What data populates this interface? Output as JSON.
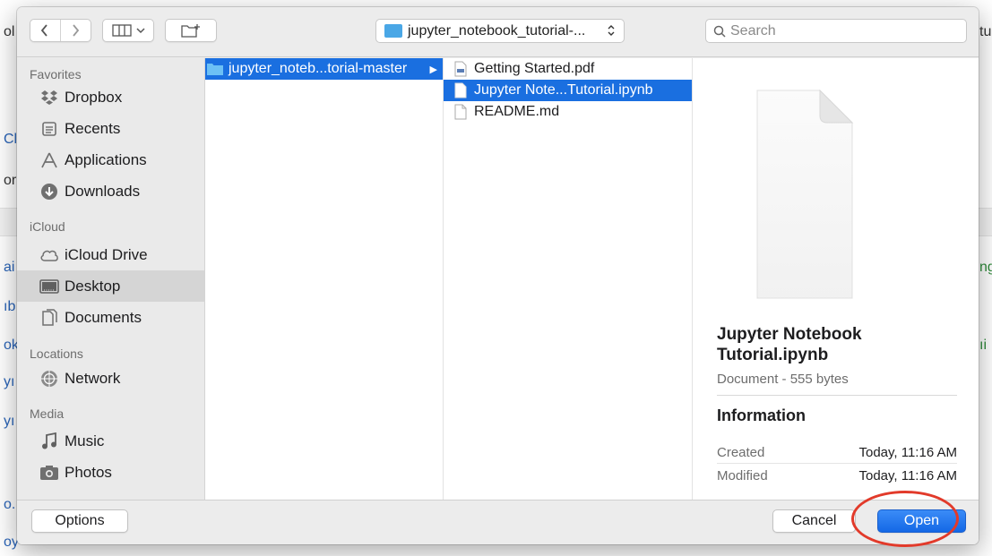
{
  "background": {
    "fragments": [
      "ol",
      "Cl",
      "or",
      "ai",
      "ıb",
      "ok",
      "yı",
      "yı",
      "o.",
      "oy",
      "tu",
      "ng",
      "ıi"
    ]
  },
  "toolbar": {
    "back_icon": "chevron-left-icon",
    "forward_icon": "chevron-right-icon",
    "view_icon": "column-view-icon",
    "new_folder_icon": "new-folder-icon",
    "path_label": "jupyter_notebook_tutorial-...",
    "search_placeholder": "Search"
  },
  "sidebar": {
    "sections": [
      {
        "header": "Favorites",
        "items": [
          {
            "label": "Dropbox",
            "icon": "dropbox-icon"
          },
          {
            "label": "Recents",
            "icon": "recents-icon"
          },
          {
            "label": "Applications",
            "icon": "applications-icon"
          },
          {
            "label": "Downloads",
            "icon": "downloads-icon"
          }
        ]
      },
      {
        "header": "iCloud",
        "items": [
          {
            "label": "iCloud Drive",
            "icon": "cloud-icon"
          },
          {
            "label": "Desktop",
            "icon": "desktop-icon",
            "selected": true
          },
          {
            "label": "Documents",
            "icon": "documents-icon"
          }
        ]
      },
      {
        "header": "Locations",
        "items": [
          {
            "label": "Network",
            "icon": "network-icon"
          }
        ]
      },
      {
        "header": "Media",
        "items": [
          {
            "label": "Music",
            "icon": "music-icon"
          },
          {
            "label": "Photos",
            "icon": "photos-icon"
          }
        ]
      }
    ]
  },
  "columns": {
    "col1": [
      {
        "label": "jupyter_noteb...torial-master",
        "icon": "folder-icon",
        "selected": true,
        "has_children": true
      }
    ],
    "col2": [
      {
        "label": "Getting Started.pdf",
        "icon": "pdf-file-icon"
      },
      {
        "label": "Jupyter Note...Tutorial.ipynb",
        "icon": "document-icon",
        "selected": true
      },
      {
        "label": "README.md",
        "icon": "document-icon"
      }
    ]
  },
  "preview": {
    "title": "Jupyter Notebook Tutorial.ipynb",
    "subtitle": "Document - 555 bytes",
    "info_heading": "Information",
    "rows": [
      {
        "key": "Created",
        "value": "Today, 11:16 AM"
      },
      {
        "key": "Modified",
        "value": "Today, 11:16 AM"
      }
    ]
  },
  "bottom": {
    "options_label": "Options",
    "cancel_label": "Cancel",
    "open_label": "Open"
  },
  "colors": {
    "accent": "#1a6fe0",
    "highlight_ring": "#e23a2a",
    "folder": "#4aa7e6"
  }
}
